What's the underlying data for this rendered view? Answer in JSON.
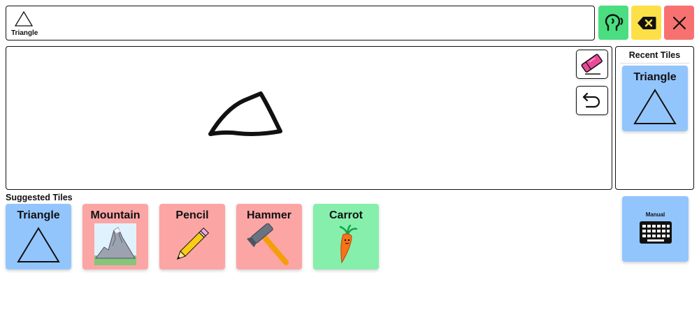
{
  "message_bar": {
    "tile_label": "Triangle",
    "tile_icon": "triangle-outline-icon"
  },
  "top_buttons": {
    "speak": {
      "icon": "speaking-head-icon",
      "color": "#4ade80"
    },
    "backspace": {
      "icon": "backspace-icon",
      "color": "#fde047"
    },
    "clear": {
      "icon": "close-x-icon",
      "color": "#f87171"
    }
  },
  "canvas": {
    "drawing": "hand-drawn-triangle",
    "tools": [
      "eraser-icon",
      "undo-icon"
    ]
  },
  "recent": {
    "title": "Recent Tiles",
    "tiles": [
      {
        "label": "Triangle",
        "color": "#93c5fd",
        "icon": "triangle-icon"
      }
    ]
  },
  "suggested": {
    "title": "Suggested Tiles",
    "tiles": [
      {
        "label": "Triangle",
        "color": "#93c5fd",
        "icon": "triangle-icon"
      },
      {
        "label": "Mountain",
        "color": "#fca5a5",
        "icon": "mountain-icon"
      },
      {
        "label": "Pencil",
        "color": "#fca5a5",
        "icon": "pencil-icon"
      },
      {
        "label": "Hammer",
        "color": "#fca5a5",
        "icon": "hammer-icon"
      },
      {
        "label": "Carrot",
        "color": "#86efac",
        "icon": "carrot-icon"
      }
    ]
  },
  "manual": {
    "label": "Manual",
    "icon": "keyboard-icon",
    "color": "#93c5fd"
  }
}
